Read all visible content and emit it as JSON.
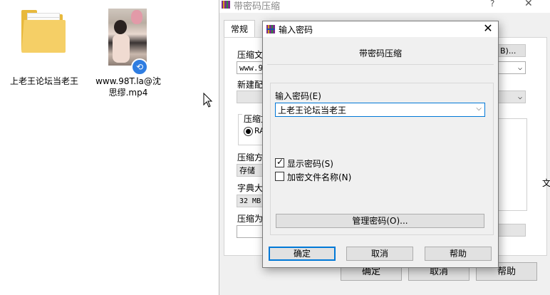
{
  "desktop": {
    "folder_label": "上老王论坛当老王",
    "video_label": "www.98T.la@沈思缪.mp4"
  },
  "bg_window": {
    "title": "带密码压缩",
    "help_glyph": "?",
    "close_glyph": "✕",
    "tab_general": "常规",
    "fragments": {
      "archive_name_label": "压缩文",
      "archive_name_value": "www.98",
      "update_mode_label": "新建配",
      "format_label": "压缩文",
      "format_option": "RA",
      "method_label": "压缩方",
      "method_value": "存储",
      "dict_label": "字典大",
      "dict_value": "32 MB",
      "volume_label": "压缩为",
      "browse_suffix": "B)...",
      "side_char": "文"
    },
    "ok": "确定",
    "cancel": "取消",
    "help": "帮助"
  },
  "dialog": {
    "title": "输入密码",
    "heading": "带密码压缩",
    "password_label": "输入密码(E)",
    "password_value": "上老王论坛当老王",
    "show_password": "显示密码(S)",
    "show_password_checked": true,
    "encrypt_names": "加密文件名称(N)",
    "encrypt_names_checked": false,
    "manage_button": "管理密码(O)...",
    "ok": "确定",
    "cancel": "取消",
    "help": "帮助",
    "accent": "#0078d7"
  }
}
